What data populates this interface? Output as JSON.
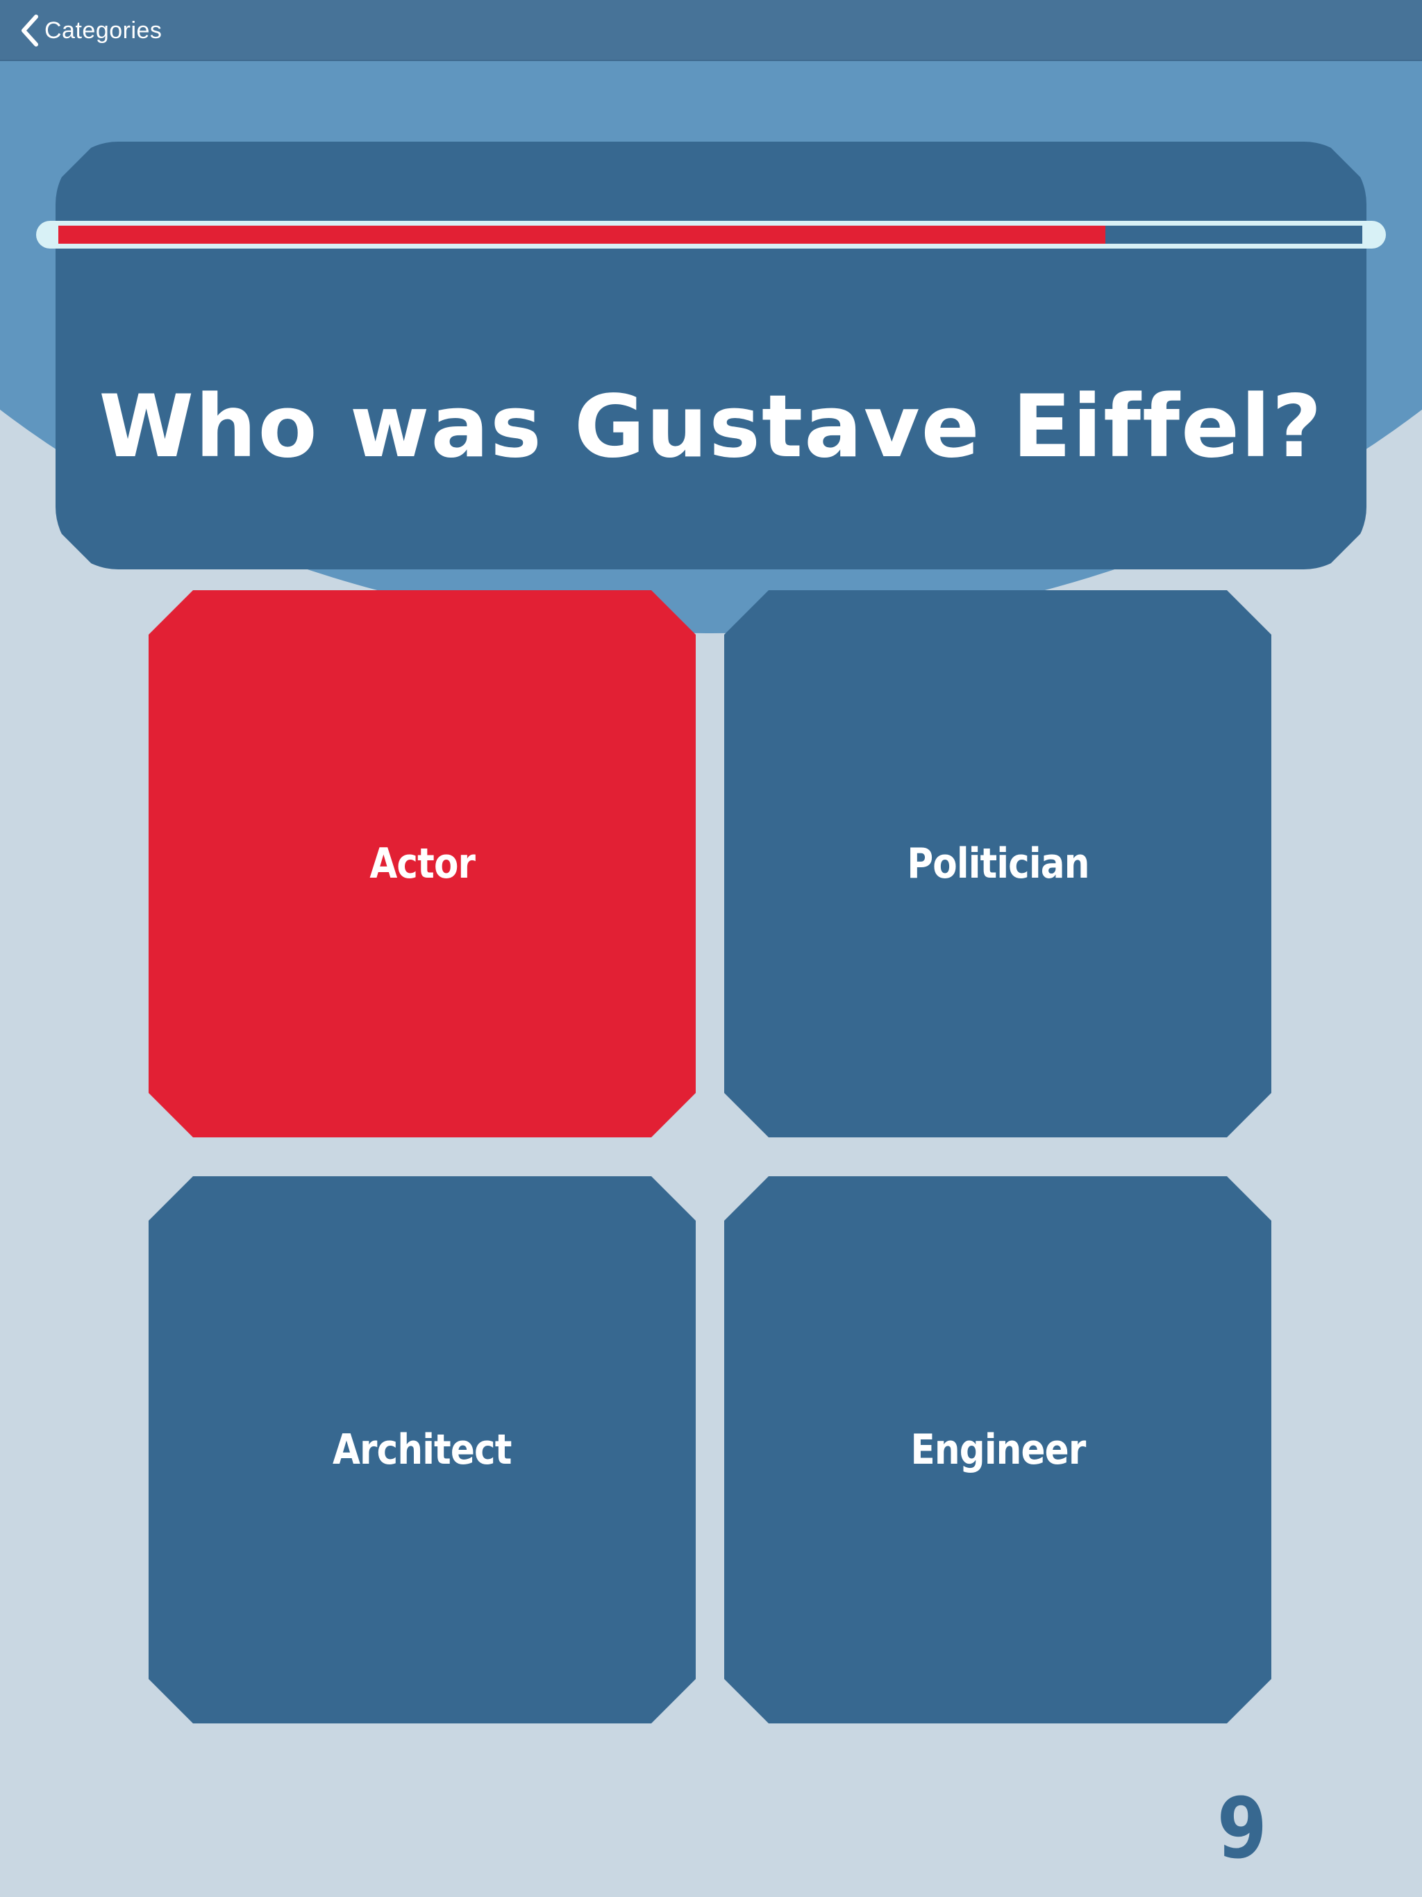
{
  "navbar": {
    "back_label": "Categories",
    "back_icon": "chevron-left-icon"
  },
  "quiz": {
    "question": "Who was Gustave Eiffel?",
    "timer_remaining_fraction": 0.803,
    "answers": [
      {
        "label": "Actor",
        "selected": true
      },
      {
        "label": "Politician",
        "selected": false
      },
      {
        "label": "Architect",
        "selected": false
      },
      {
        "label": "Engineer",
        "selected": false
      }
    ],
    "question_number": "9"
  },
  "colors": {
    "card_blue": "#376890",
    "accent_red": "#e22034",
    "header_blue": "#477398",
    "hero_blue": "#6096bf",
    "background": "#c9d7e2",
    "track_light": "#d8f1f6"
  }
}
